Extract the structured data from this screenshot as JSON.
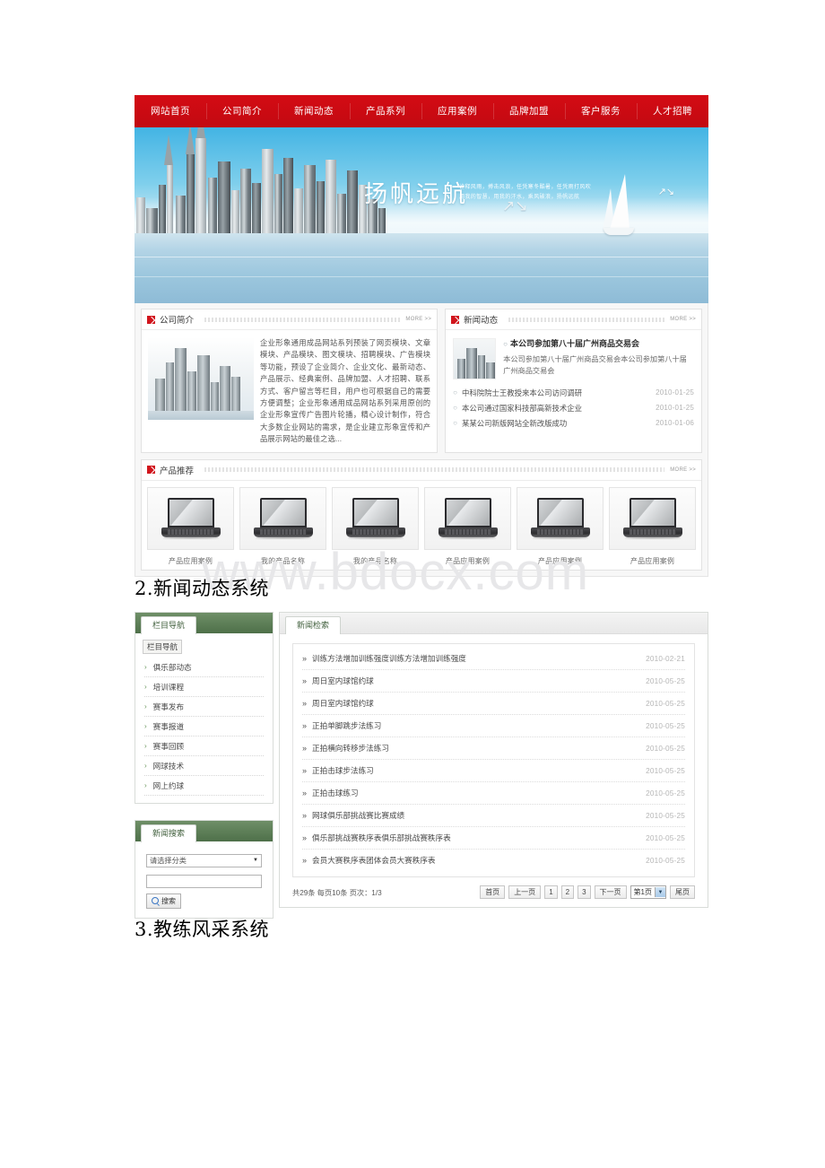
{
  "colors": {
    "nav_red": "#cf0a13",
    "nav_underline": "#2eb8e6",
    "accent_green": "#4e7049",
    "link_gray": "#b4b4b4"
  },
  "watermark": "www.bdocx.com",
  "site_shot": {
    "nav": [
      {
        "label": "网站首页"
      },
      {
        "label": "公司简介"
      },
      {
        "label": "新闻动态"
      },
      {
        "label": "产品系列"
      },
      {
        "label": "应用案例"
      },
      {
        "label": "品牌加盟"
      },
      {
        "label": "客户服务"
      },
      {
        "label": "人才招聘"
      }
    ],
    "banner": {
      "title": "扬帆远航",
      "subtitle_line1": "诠释风雨，搏击风浪，任凭寒冬酷暑，任凭雨打风吹",
      "subtitle_line2": "用我的智慧，用我的汗水，乘风破浪，扬帆远航"
    },
    "about": {
      "heading": "公司简介",
      "more": "MORE >>",
      "body": "企业形象通用成品网站系列预装了网页模块、文章模块、产品模块、图文模块、招聘模块、广告模块等功能，预设了企业简介、企业文化、最新动态、产品展示、经典案例、品牌加盟、人才招聘、联系方式、客户留言等栏目，用户也可根据自己的需要方便调整；企业形象通用成品网站系列采用原创的企业形象宣传广告图片轮播，精心设计制作，符合大多数企业网站的需求，是企业建立形象宣传和产品展示网站的最佳之选..."
    },
    "news": {
      "heading": "新闻动态",
      "more": "MORE >>",
      "lead": {
        "title": "本公司参加第八十届广州商品交易会",
        "desc": "本公司参加第八十届广州商品交易会本公司参加第八十届广州商品交易会"
      },
      "items": [
        {
          "title": "中科院院士王教授来本公司访问调研",
          "date": "2010-01-25"
        },
        {
          "title": "本公司通过国家科技部高新技术企业",
          "date": "2010-01-25"
        },
        {
          "title": "某某公司新版网站全新改版成功",
          "date": "2010-01-06"
        }
      ]
    },
    "products": {
      "heading": "产品推荐",
      "more": "MORE >>",
      "items": [
        {
          "label": "产品应用案例"
        },
        {
          "label": "我的产品名称"
        },
        {
          "label": "我的产品名称"
        },
        {
          "label": "产品应用案例"
        },
        {
          "label": "产品应用案例"
        },
        {
          "label": "产品应用案例"
        }
      ]
    }
  },
  "heading_news_system": "2.新闻动态系统",
  "heading_coach_system": "3.教练风采系统",
  "news_shot": {
    "sidebar": {
      "tab_label": "栏目导航",
      "group_label": "栏目导航",
      "items": [
        {
          "label": "俱乐部动态"
        },
        {
          "label": "培训课程"
        },
        {
          "label": "赛事发布"
        },
        {
          "label": "赛事报道"
        },
        {
          "label": "赛事回顾"
        },
        {
          "label": "网球技术"
        },
        {
          "label": "网上约球"
        }
      ]
    },
    "search": {
      "tab_label": "新闻搜索",
      "category_value": "请选择分类",
      "keyword_value": "",
      "keyword_placeholder": "",
      "button_label": "搜索"
    },
    "main": {
      "tab_label": "新闻检索",
      "rows": [
        {
          "title": "训练方法增加训练强度训练方法增加训练强度",
          "date": "2010-02-21"
        },
        {
          "title": "周日室内球馆约球",
          "date": "2010-05-25"
        },
        {
          "title": "周日室内球馆约球",
          "date": "2010-05-25"
        },
        {
          "title": "正拍单脚跳步法练习",
          "date": "2010-05-25"
        },
        {
          "title": "正拍横向转移步法练习",
          "date": "2010-05-25"
        },
        {
          "title": "正拍击球步法练习",
          "date": "2010-05-25"
        },
        {
          "title": "正拍击球练习",
          "date": "2010-05-25"
        },
        {
          "title": "网球俱乐部挑战赛比赛成绩",
          "date": "2010-05-25"
        },
        {
          "title": "俱乐部挑战赛秩序表俱乐部挑战赛秩序表",
          "date": "2010-05-25"
        },
        {
          "title": "会员大赛秩序表团体会员大赛秩序表",
          "date": "2010-05-25"
        }
      ],
      "pager": {
        "summary": "共29条 每页10条 页次：1/3",
        "first": "首页",
        "prev": "上一页",
        "page1": "1",
        "page2": "2",
        "page3": "3",
        "next": "下一页",
        "jump_value": "第1页",
        "last": "尾页"
      }
    }
  }
}
